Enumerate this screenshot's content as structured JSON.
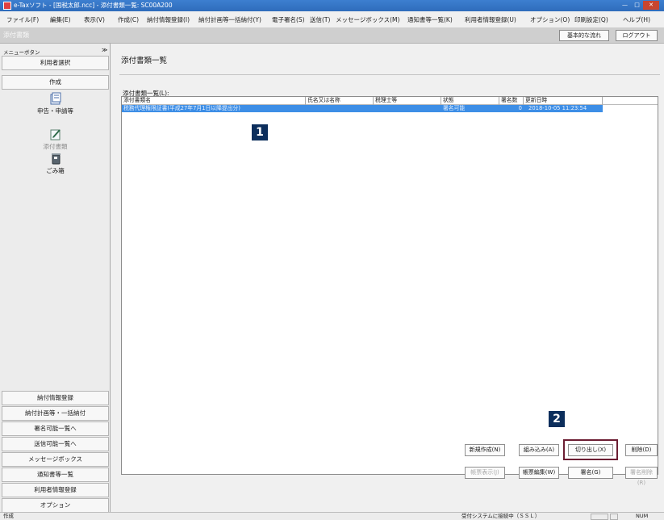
{
  "window": {
    "title": "e-Taxソフト - [国税太郎.ncc] - 添付書類一覧: SC00A200",
    "controls": [
      "—",
      "□",
      "✕"
    ]
  },
  "menubar": [
    "ファイル(F)",
    "編集(E)",
    "表示(V)",
    "作成(C)",
    "納付情報登録(I)",
    "納付計画等一括納付(Y)",
    "電子署名(S)",
    "送信(T)",
    "メッセージボックス(M)",
    "通知書等一覧(K)",
    "利用者情報登録(U)",
    "オプション(O)",
    "印刷設定(Q)",
    "ヘルプ(H)"
  ],
  "header": {
    "section_title": "添付書類",
    "basic_flow_button": "基本的な流れ",
    "logout_button": "ログアウト"
  },
  "sidebar": {
    "menu_header": "メニューボタン",
    "collapse_symbol": "≫",
    "user_select": "利用者選択",
    "create": "作成",
    "icons": [
      {
        "label": "申告・申請等",
        "icon": "document-form-icon"
      },
      {
        "label": "添付書類",
        "icon": "attachment-pen-icon"
      },
      {
        "label": "ごみ箱",
        "icon": "trash-bin-icon"
      }
    ],
    "bottom_buttons": [
      "納付情報登録",
      "納付計画等・一括納付",
      "署名可能一覧へ",
      "送信可能一覧へ",
      "メッセージボックス",
      "通知書等一覧",
      "利用者情報登録",
      "オプション"
    ]
  },
  "main": {
    "title": "添付書類一覧",
    "list_label": "添付書類一覧(L):",
    "columns": [
      "添付書類名",
      "氏名又は名称",
      "税理士等",
      "状態",
      "署名数",
      "更新日時"
    ],
    "rows": [
      {
        "name": "税務代理権限証書(平成27年7月1日以降提出分)",
        "client": "",
        "accountant": "",
        "status": "署名可能",
        "signatures": "0",
        "updated": "2018-10-05 11:23:54"
      }
    ]
  },
  "actions": {
    "row1": [
      {
        "label": "新規作成(N)",
        "enabled": true
      },
      {
        "label": "組み込み(A)",
        "enabled": true
      },
      {
        "label": "切り出し(X)",
        "enabled": true
      },
      {
        "label": "削除(D)",
        "enabled": true
      }
    ],
    "row2": [
      {
        "label": "帳票表示(J)",
        "enabled": false
      },
      {
        "label": "帳票編集(W)",
        "enabled": true
      },
      {
        "label": "署名(G)",
        "enabled": true
      },
      {
        "label": "署名削除(R)",
        "enabled": false
      }
    ]
  },
  "callouts": [
    "1",
    "2"
  ],
  "statusbar": {
    "left": "作成",
    "connection": "受付システムに接続中（ＳＳＬ）",
    "num": "NUM"
  },
  "colors": {
    "selected_row": "#3d8ee6",
    "callout": "#0c2e5c",
    "highlight_border": "#6b1d32",
    "titlebar": "#3d7fd0"
  }
}
